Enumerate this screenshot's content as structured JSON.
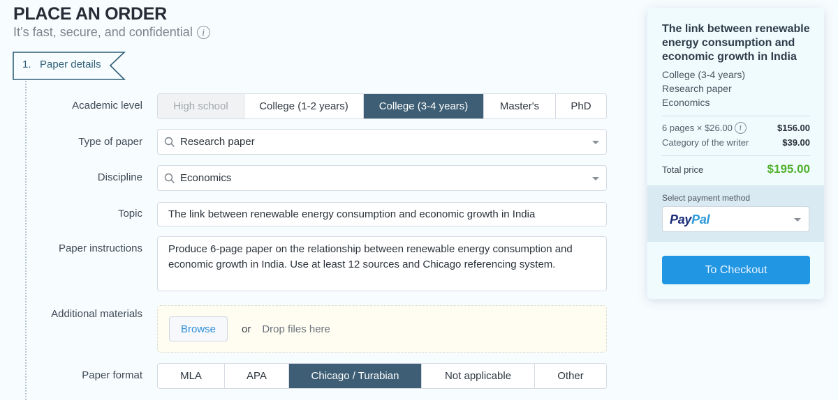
{
  "header": {
    "title": "PLACE AN ORDER",
    "subtitle": "It’s fast, secure, and confidential",
    "info_glyph": "i"
  },
  "step": {
    "number": "1.",
    "label": "Paper details"
  },
  "form": {
    "academic_level": {
      "label": "Academic level",
      "options": [
        {
          "label": "High school",
          "state": "disabled"
        },
        {
          "label": "College (1-2 years)",
          "state": "normal"
        },
        {
          "label": "College (3-4 years)",
          "state": "selected"
        },
        {
          "label": "Master's",
          "state": "normal"
        },
        {
          "label": "PhD",
          "state": "normal"
        }
      ]
    },
    "type_of_paper": {
      "label": "Type of paper",
      "value": "Research paper"
    },
    "discipline": {
      "label": "Discipline",
      "value": "Economics"
    },
    "topic": {
      "label": "Topic",
      "value": "The link between renewable energy consumption and economic growth in India"
    },
    "instructions": {
      "label": "Paper instructions",
      "value": "Produce 6-page paper on the relationship between renewable energy consumption and economic growth in India. Use at least 12 sources and Chicago referencing system."
    },
    "materials": {
      "label": "Additional materials",
      "browse": "Browse",
      "or": "or",
      "drop": "Drop files here"
    },
    "paper_format": {
      "label": "Paper format",
      "options": [
        {
          "label": "MLA",
          "state": "normal"
        },
        {
          "label": "APA",
          "state": "normal"
        },
        {
          "label": "Chicago / Turabian",
          "state": "selected"
        },
        {
          "label": "Not applicable",
          "state": "normal"
        },
        {
          "label": "Other",
          "state": "normal"
        }
      ]
    }
  },
  "summary": {
    "title": "The link between renewable energy consumption and economic growth in India",
    "level": "College (3-4 years)",
    "type": "Research paper",
    "discipline": "Economics",
    "pages_line": "6 pages × $26.00",
    "pages_amount": "$156.00",
    "writer_line": "Category of the writer",
    "writer_amount": "$39.00",
    "total_label": "Total price",
    "total_amount": "$195.00",
    "payment_label": "Select payment method",
    "payment_method_part1": "Pay",
    "payment_method_part2": "Pal",
    "checkout": "To Checkout",
    "colors": {
      "total": "#52b02c",
      "checkout": "#2196e3",
      "selected": "#3d5e74"
    }
  }
}
